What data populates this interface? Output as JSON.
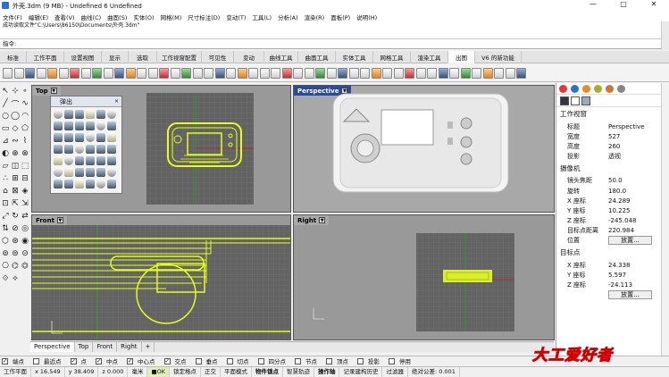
{
  "window": {
    "title": "外壳.3dm (9 MB) - Undefined 6 Undefined",
    "min": "—",
    "max": "□",
    "close": "✕"
  },
  "menu": [
    "文件(F)",
    "编辑(E)",
    "查看(V)",
    "曲线(C)",
    "曲面(S)",
    "实体(O)",
    "网格(M)",
    "尺寸标注(D)",
    "变动(T)",
    "工具(L)",
    "分析(A)",
    "渲染(R)",
    "面板(P)",
    "说明(H)"
  ],
  "command": {
    "history1": "",
    "history2": "成功读取文件\"C:\\Users\\86150\\Documents\\外壳.3dm\"",
    "prompt": "指令:"
  },
  "tabs": [
    "标准",
    "工作平面",
    "设置视图",
    "显示",
    "选取",
    "工作视窗配置",
    "可见性",
    "变动",
    "曲线工具",
    "曲面工具",
    "实体工具",
    "网格工具",
    "渲染工具",
    "出图",
    "V6 的新功能"
  ],
  "active_tab": "出图",
  "viewports": {
    "top": "Top",
    "perspective": "Perspective",
    "front": "Front",
    "right": "Right"
  },
  "float_panel": {
    "title": "弹出"
  },
  "viewport_tabs": [
    "Perspective",
    "Top",
    "Front",
    "Right",
    "+"
  ],
  "osnaps": [
    {
      "label": "端点",
      "checked": true
    },
    {
      "label": "最近点",
      "checked": false
    },
    {
      "label": "点",
      "checked": true
    },
    {
      "label": "中点",
      "checked": true
    },
    {
      "label": "中心点",
      "checked": true
    },
    {
      "label": "交点",
      "checked": true
    },
    {
      "label": "垂点",
      "checked": false
    },
    {
      "label": "切点",
      "checked": false
    },
    {
      "label": "四分点",
      "checked": false
    },
    {
      "label": "节点",
      "checked": false
    },
    {
      "label": "顶点",
      "checked": false
    },
    {
      "label": "投影",
      "checked": false
    },
    {
      "label": "停用",
      "checked": false
    }
  ],
  "status": {
    "cplane": "工作平面",
    "x": "x 16.549",
    "y": "y 38.409",
    "z": "z 0.000",
    "unit": "毫米",
    "layer": "■OK",
    "items": [
      "锁定格点",
      "正交",
      "平面模式",
      "物件锁点",
      "智慧轨迹",
      "操作轴",
      "记录建构历史",
      "过滤器",
      "绝对公差: 0.001"
    ]
  },
  "properties": {
    "section_view": "工作视窗",
    "view_rows": [
      {
        "k": "标题",
        "v": "Perspective"
      },
      {
        "k": "宽度",
        "v": "527"
      },
      {
        "k": "高度",
        "v": "260"
      },
      {
        "k": "投影",
        "v": "透视"
      }
    ],
    "section_camera": "摄像机",
    "camera_rows": [
      {
        "k": "镜头焦距",
        "v": "50.0"
      },
      {
        "k": "旋转",
        "v": "180.0"
      },
      {
        "k": "X 座标",
        "v": "24.289"
      },
      {
        "k": "Y 座标",
        "v": "10.225"
      },
      {
        "k": "Z 座标",
        "v": "-245.048"
      },
      {
        "k": "目标点距离",
        "v": "220.984"
      },
      {
        "k": "位置",
        "v": "放置..."
      }
    ],
    "section_target": "目标点",
    "target_rows": [
      {
        "k": "X 座标",
        "v": "24.338"
      },
      {
        "k": "Y 座标",
        "v": "5.597"
      },
      {
        "k": "Z 座标",
        "v": "-24.113"
      },
      {
        "k": "",
        "v": "放置..."
      }
    ]
  },
  "logo_text": "大工爱好者",
  "colors": {
    "selection": "#e6ff1a",
    "grid_bg": "#5c5c5c",
    "viewport_bg": "#9a9a9a",
    "active_header": "#2a4a9a"
  }
}
